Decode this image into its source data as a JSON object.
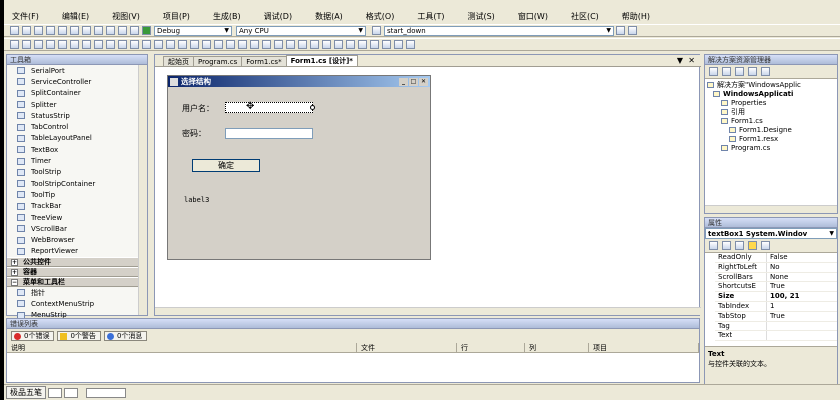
{
  "menu": [
    "文件(F)",
    "编辑(E)",
    "视图(V)",
    "项目(P)",
    "生成(B)",
    "调试(D)",
    "数据(A)",
    "格式(O)",
    "工具(T)",
    "测试(S)",
    "窗口(W)",
    "社区(C)",
    "帮助(H)"
  ],
  "toolbar": {
    "config": "Debug",
    "platform": "Any CPU",
    "find": "start_down"
  },
  "toolbox": {
    "title": "工具箱",
    "items": [
      {
        "label": "SerialPort",
        "icon": "serialport-icon"
      },
      {
        "label": "ServiceController",
        "icon": "servicecontroller-icon"
      },
      {
        "label": "SplitContainer",
        "icon": "splitcontainer-icon"
      },
      {
        "label": "Splitter",
        "icon": "splitter-icon"
      },
      {
        "label": "StatusStrip",
        "icon": "statusstrip-icon"
      },
      {
        "label": "TabControl",
        "icon": "tabcontrol-icon"
      },
      {
        "label": "TableLayoutPanel",
        "icon": "tablelayoutpanel-icon"
      },
      {
        "label": "TextBox",
        "icon": "textbox-icon"
      },
      {
        "label": "Timer",
        "icon": "timer-icon"
      },
      {
        "label": "ToolStrip",
        "icon": "toolstrip-icon"
      },
      {
        "label": "ToolStripContainer",
        "icon": "toolstripcontainer-icon"
      },
      {
        "label": "ToolTip",
        "icon": "tooltip-icon"
      },
      {
        "label": "TrackBar",
        "icon": "trackbar-icon"
      },
      {
        "label": "TreeView",
        "icon": "treeview-icon"
      },
      {
        "label": "VScrollBar",
        "icon": "vscrollbar-icon"
      },
      {
        "label": "WebBrowser",
        "icon": "webbrowser-icon"
      },
      {
        "label": "ReportViewer",
        "icon": "reportviewer-icon"
      }
    ],
    "categories": [
      "公共控件",
      "容器",
      "菜单和工具栏"
    ],
    "tail_items": [
      "指针",
      "ContextMenuStrip",
      "MenuStrip"
    ]
  },
  "tabs": [
    "起始页",
    "Program.cs",
    "Form1.cs*",
    "Form1.cs [设计]*"
  ],
  "form": {
    "title": "选择结构",
    "username_label": "用户名：",
    "password_label": "密码：",
    "button": "确定",
    "label3": "label3"
  },
  "solution": {
    "title": "解决方案资源管理器",
    "rows": [
      "解决方案\"WindowsApplic",
      "WindowsApplicati",
      "Properties",
      "引用",
      "Form1.cs",
      "Form1.Designe",
      "Form1.resx",
      "Program.cs"
    ]
  },
  "properties": {
    "title": "属性",
    "object": "textBox1 System.Windov",
    "rows": [
      {
        "name": "ReadOnly",
        "value": "False"
      },
      {
        "name": "RightToLeft",
        "value": "No"
      },
      {
        "name": "ScrollBars",
        "value": "None"
      },
      {
        "name": "ShortcutsE",
        "value": "True"
      },
      {
        "name": "Size",
        "value": "100, 21"
      },
      {
        "name": "TabIndex",
        "value": "1"
      },
      {
        "name": "TabStop",
        "value": "True"
      },
      {
        "name": "Tag",
        "value": ""
      },
      {
        "name": "Text",
        "value": ""
      }
    ],
    "desc_title": "Text",
    "desc_text": "与控件关联的文本。"
  },
  "errors": {
    "title": "错误列表",
    "errors_btn": "0个错误",
    "warnings_btn": "0个警告",
    "messages_btn": "0个消息",
    "columns": [
      "说明",
      "文件",
      "行",
      "列",
      "项目"
    ]
  },
  "status": "极品五笔"
}
